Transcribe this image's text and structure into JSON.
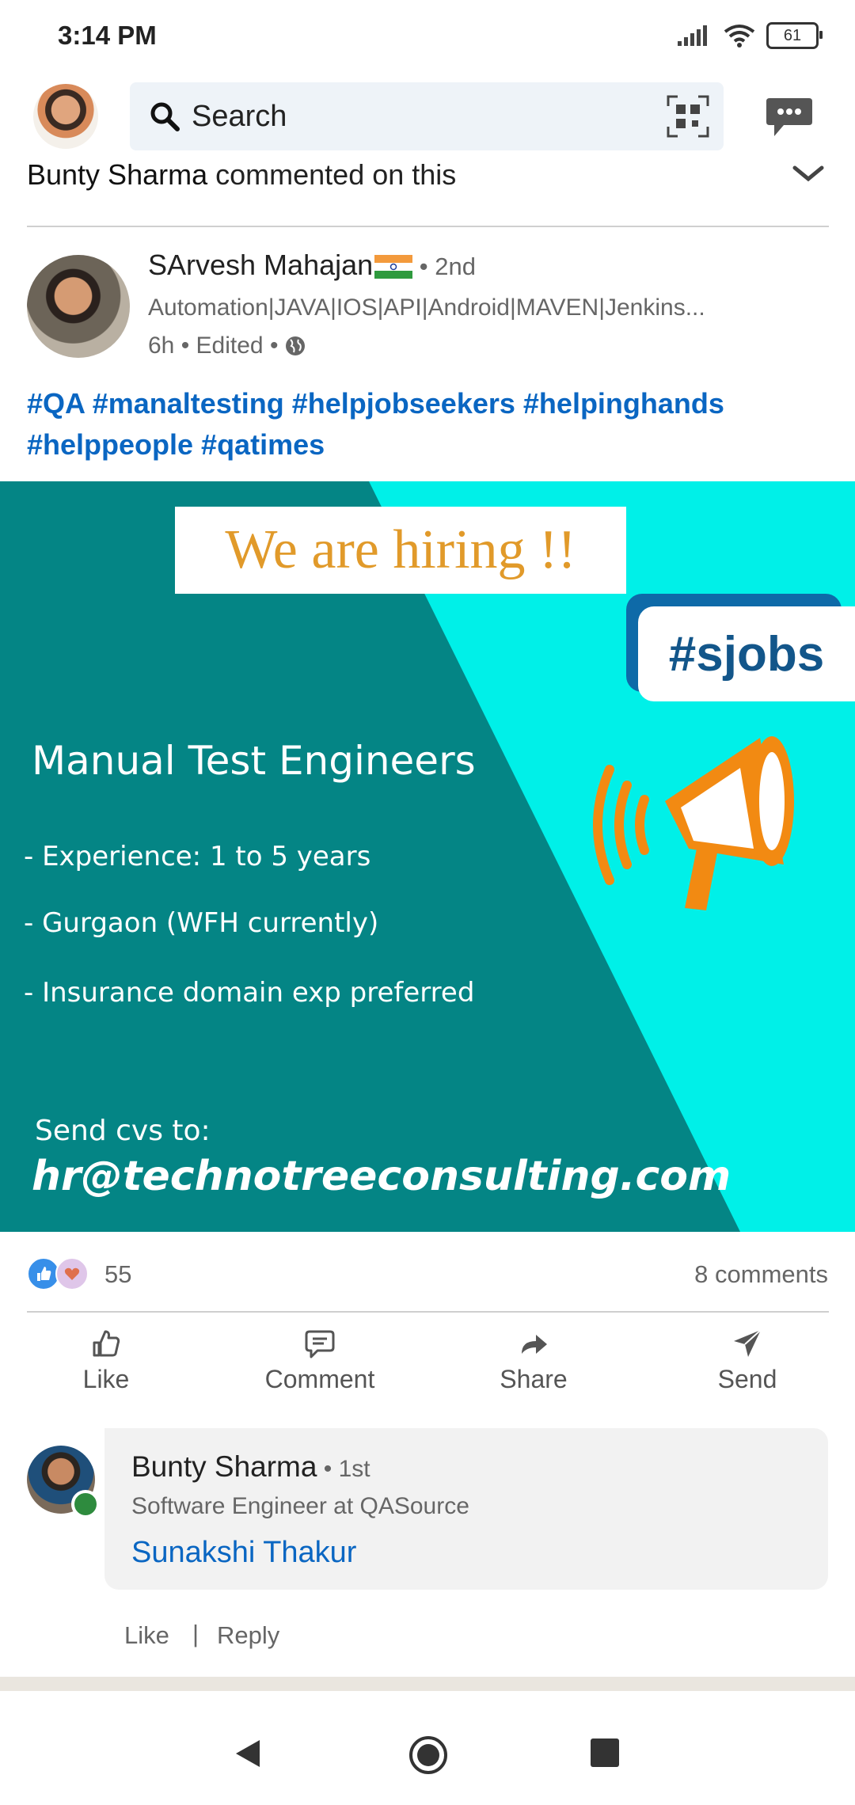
{
  "status_bar": {
    "time": "3:14 PM",
    "battery": "61"
  },
  "search": {
    "placeholder": "Search"
  },
  "activity": {
    "actor": "Bunty Sharma",
    "action": " commented on this"
  },
  "author": {
    "name": "SArvesh Mahajan",
    "degree": " • 2nd",
    "headline": "Automation|JAVA|IOS|API|Android|MAVEN|Jenkins...",
    "time": "6h • Edited •"
  },
  "post": {
    "hashtags": "#QA #manaltesting #helpjobseekers #helpinghands #helppeople #qatimes",
    "image": {
      "banner": "We are hiring !!",
      "tag": "#sjobs",
      "title": "Manual Test Engineers",
      "requirements": [
        "- Experience: 1 to 5 years",
        "- Gurgaon (WFH currently)",
        "- Insurance domain exp preferred"
      ],
      "send_label": "Send cvs to:",
      "email": "hr@technotreeconsulting.com"
    }
  },
  "social": {
    "reactions": "55",
    "comments": "8 comments"
  },
  "actions": {
    "like": "Like",
    "comment": "Comment",
    "share": "Share",
    "send": "Send"
  },
  "comment": {
    "name": "Bunty Sharma",
    "degree": " • 1st",
    "headline": "Software Engineer at QASource",
    "mention": "Sunakshi Thakur",
    "like": "Like",
    "separator": "|",
    "reply": "Reply"
  },
  "colors": {
    "link_blue": "#0a66c2",
    "image_teal": "#048585",
    "image_cyan": "#00f0e8",
    "banner_orange": "#e19a2a",
    "sjobs_blue": "#13568a"
  }
}
